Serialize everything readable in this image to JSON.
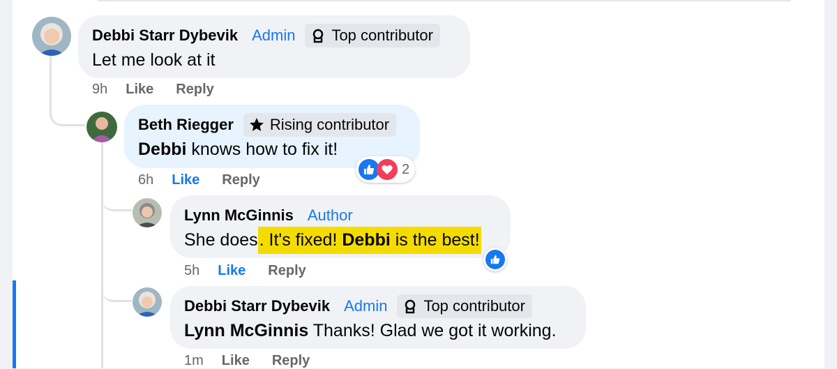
{
  "comments": [
    {
      "author": "Debbi Starr Dybevik",
      "role": "Admin",
      "badge": "Top contributor",
      "badge_icon": "award-icon",
      "text": "Let me look at it",
      "time": "9h",
      "like": "Like",
      "reply": "Reply"
    },
    {
      "author": "Beth Riegger",
      "badge": "Rising contributor",
      "badge_icon": "star-icon",
      "mention": "Debbi",
      "text": " knows how to fix it!",
      "time": "6h",
      "like": "Like",
      "like_active": true,
      "reply": "Reply",
      "reactions": {
        "icons": [
          "like-reaction-icon",
          "love-reaction-icon"
        ],
        "count": "2"
      }
    },
    {
      "author": "Lynn McGinnis",
      "role": "Author",
      "text_plain": "She does",
      "text_hl_start": ". It's fixed! ",
      "text_hl_mention": "Debbi",
      "text_hl_end": " is the best!",
      "time": "5h",
      "like": "Like",
      "like_active": true,
      "reply": "Reply",
      "reactions": {
        "icons": [
          "like-reaction-icon"
        ]
      }
    },
    {
      "author": "Debbi Starr Dybevik",
      "role": "Admin",
      "badge": "Top contributor",
      "badge_icon": "award-icon",
      "mention": "Lynn McGinnis",
      "text": " Thanks! Glad we got it working.",
      "time": "1m",
      "like": "Like",
      "reply": "Reply"
    }
  ],
  "colors": {
    "role": "#1877f2",
    "highlight": "#f5dc00",
    "bubble": "#f0f2f5",
    "bubble_active": "#e7f3ff",
    "love": "#f33e58"
  }
}
